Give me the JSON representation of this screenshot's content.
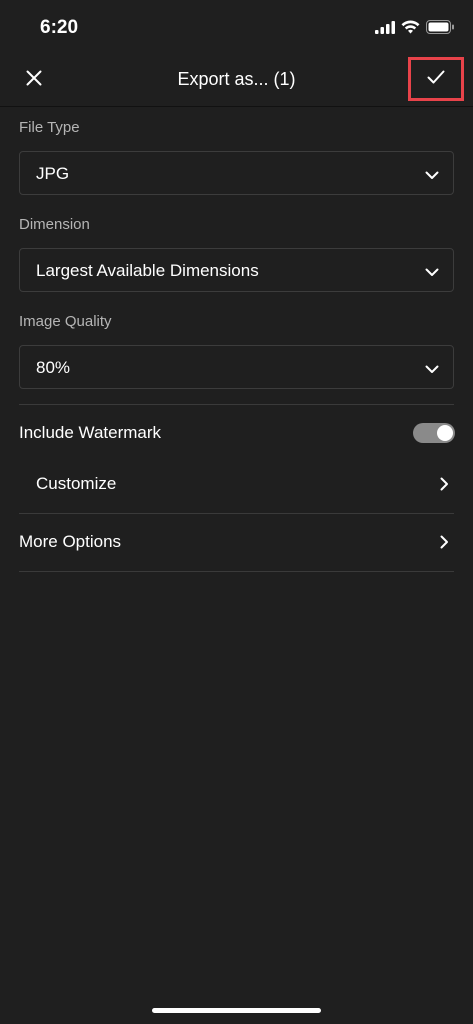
{
  "status_bar": {
    "time": "6:20",
    "icons": [
      "cellular-signal-icon",
      "wifi-icon",
      "battery-icon"
    ]
  },
  "header": {
    "title": "Export as... (1)",
    "close_icon": "close-icon",
    "confirm_icon": "checkmark-icon",
    "confirm_highlight_color": "#e8434a"
  },
  "file_type": {
    "label": "File Type",
    "value": "JPG"
  },
  "dimension": {
    "label": "Dimension",
    "value": "Largest Available Dimensions"
  },
  "image_quality": {
    "label": "Image Quality",
    "value": "80%"
  },
  "watermark": {
    "label": "Include Watermark",
    "enabled": true,
    "customize_label": "Customize"
  },
  "more_options": {
    "label": "More Options"
  }
}
